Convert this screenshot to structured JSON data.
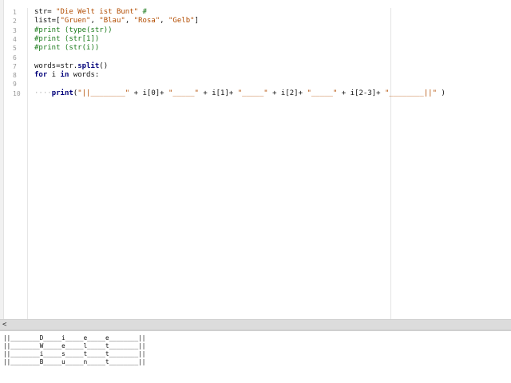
{
  "editor": {
    "line_numbers": [
      "1",
      "2",
      "3",
      "4",
      "5",
      "6",
      "7",
      "8",
      "9",
      "10"
    ],
    "lines": {
      "l1": {
        "a": "str= ",
        "b": "\"Die Welt ist Bunt\"",
        "c": " #"
      },
      "l2": {
        "a": "list=[",
        "b": "\"Gruen\"",
        "c": ", ",
        "d": "\"Blau\"",
        "e": ", ",
        "f": "\"Rosa\"",
        "g": ", ",
        "h": "\"Gelb\"",
        "i": "]"
      },
      "l3": "#print (type(str))",
      "l4": "#print (str[1])",
      "l5": "#print (str(i))",
      "l7": {
        "a": "words=str.",
        "b": "split",
        "c": "()"
      },
      "l8": {
        "a": "for",
        "b": " i ",
        "c": "in",
        "d": " words:"
      },
      "l10": {
        "indent": "····",
        "fn": "print",
        "p1": "(",
        "s1": "\"||________\"",
        "p2": " + i[0]+ ",
        "s2": "\"_____\"",
        "p3": " + i[1]+ ",
        "s3": "\"_____\"",
        "p4": " + i[2]+ ",
        "s4": "\"_____\"",
        "p5": " + i[2-3]+ ",
        "s5": "\"________||\"",
        "p6": " )"
      }
    }
  },
  "scrollbar": {
    "left_arrow": "<"
  },
  "output": {
    "lines": [
      "||________D_____i_____e_____e________||",
      "||________W_____e_____l_____t________||",
      "||________i_____s_____t_____t________||",
      "||________B_____u_____n_____t________||"
    ]
  },
  "colors": {
    "string": "#b24c00",
    "comment": "#1a7a1a",
    "keyword": "#00007a",
    "line_number": "#9a9a9a"
  }
}
